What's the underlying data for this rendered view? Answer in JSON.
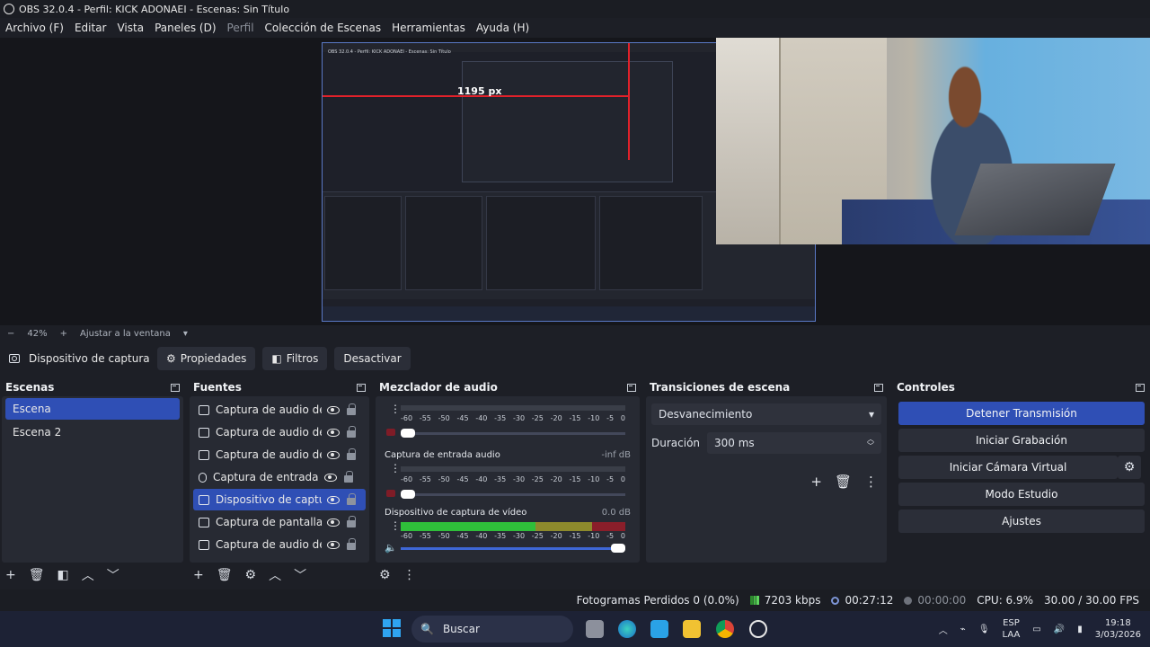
{
  "window": {
    "title": "OBS 32.0.4 - Perfil: KICK ADONAEI - Escenas: Sin Título"
  },
  "menu": [
    "Archivo (F)",
    "Editar",
    "Vista",
    "Paneles (D)",
    "Perfil",
    "Colección de Escenas",
    "Herramientas",
    "Ayuda (H)"
  ],
  "preview": {
    "nested_title": "OBS 32.0.4 - Perfil: KICK ADONAEI - Escenas: Sin Título",
    "measure_label": "1195 px",
    "zoom_minus": "−",
    "zoom": "42%",
    "zoom_plus": "+",
    "fit_label": "Ajustar a la ventana"
  },
  "source_toolbar": {
    "source": "Dispositivo de captura de v",
    "props": "Propiedades",
    "filters": "Filtros",
    "deactivate": "Desactivar"
  },
  "scenes": {
    "title": "Escenas",
    "items": [
      "Escena",
      "Escena 2"
    ]
  },
  "sources": {
    "title": "Fuentes",
    "items": [
      "Captura de audio de ap",
      "Captura de audio de ap",
      "Captura de audio de ap",
      "Captura de entrada auc",
      "Dispositivo de captura d",
      "Captura de pantalla",
      "Captura de audio de ap"
    ]
  },
  "mixer": {
    "title": "Mezclador de audio",
    "scale": [
      "-60",
      "-55",
      "-50",
      "-45",
      "-40",
      "-35",
      "-30",
      "-25",
      "-20",
      "-15",
      "-10",
      "-5",
      "0"
    ],
    "channels": [
      {
        "name": "Captura de entrada audio",
        "db": "-inf dB",
        "level": 0
      },
      {
        "name": "Dispositivo de captura de vídeo",
        "db": "0.0 dB",
        "level": 1
      }
    ]
  },
  "transitions": {
    "title": "Transiciones de escena",
    "selected": "Desvanecimiento",
    "duration_label": "Duración",
    "duration_value": "300 ms"
  },
  "controls": {
    "title": "Controles",
    "buttons": [
      "Detener Transmisión",
      "Iniciar Grabación",
      "Iniciar Cámara Virtual",
      "Modo Estudio",
      "Ajustes"
    ]
  },
  "status": {
    "dropped": "Fotogramas Perdidos 0 (0.0%)",
    "bitrate": "7203 kbps",
    "stream_time": "00:27:12",
    "rec_time": "00:00:00",
    "cpu": "CPU: 6.9%",
    "fps": "30.00 / 30.00 FPS"
  },
  "taskbar": {
    "search": "Buscar",
    "lang1": "ESP",
    "lang2": "LAA",
    "time": "19:18",
    "date": "3/03/2026"
  },
  "colors": {
    "accent": "#2f4fb5",
    "bg": "#1d1f26",
    "panel": "#272a33",
    "meter_green": "#3fc93f",
    "meter_red": "#c0262f"
  }
}
